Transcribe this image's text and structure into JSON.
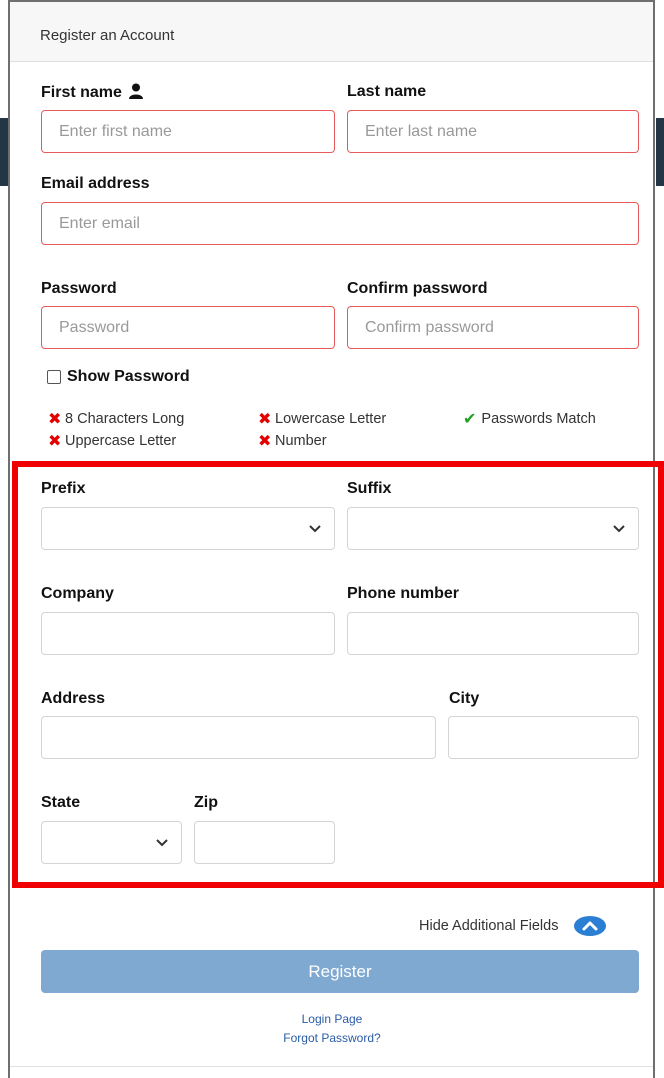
{
  "header": {
    "title": "Register an Account"
  },
  "labels": {
    "first_name": "First name",
    "last_name": "Last name",
    "email": "Email address",
    "password": "Password",
    "confirm_password": "Confirm password",
    "show_password": "Show Password",
    "prefix": "Prefix",
    "suffix": "Suffix",
    "company": "Company",
    "phone": "Phone number",
    "address": "Address",
    "city": "City",
    "state": "State",
    "zip": "Zip"
  },
  "placeholders": {
    "first_name": "Enter first name",
    "last_name": "Enter last name",
    "email": "Enter email",
    "password": "Password",
    "confirm_password": "Confirm password"
  },
  "requirements": {
    "length": "8 Characters Long",
    "uppercase": "Uppercase Letter",
    "lowercase": "Lowercase Letter",
    "number": "Number",
    "match": "Passwords Match"
  },
  "toggle": {
    "label": "Hide Additional Fields"
  },
  "buttons": {
    "register": "Register"
  },
  "links": {
    "login": "Login Page",
    "forgot": "Forgot Password?"
  },
  "colors": {
    "invalid_border": "#e85a5a",
    "error_x": "#e30000",
    "ok_check": "#22a022",
    "register_bg": "#7fa9d1",
    "toggle_icon": "#2a7fd4",
    "highlight": "#f00000"
  }
}
